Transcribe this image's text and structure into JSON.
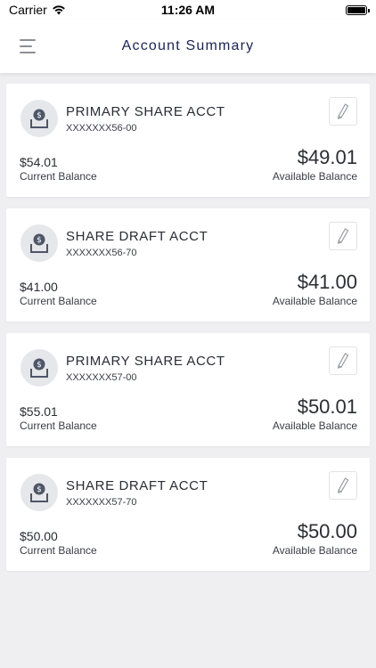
{
  "status_bar": {
    "carrier": "Carrier",
    "time": "11:26 AM"
  },
  "header": {
    "title": "Account Summary"
  },
  "accounts": [
    {
      "name": "PRIMARY SHARE ACCT",
      "number": "XXXXXXX56-00",
      "current_balance": "$54.01",
      "current_label": "Current Balance",
      "available_balance": "$49.01",
      "available_label": "Available Balance"
    },
    {
      "name": "SHARE DRAFT ACCT",
      "number": "XXXXXXX56-70",
      "current_balance": "$41.00",
      "current_label": "Current Balance",
      "available_balance": "$41.00",
      "available_label": "Available Balance"
    },
    {
      "name": "PRIMARY SHARE ACCT",
      "number": "XXXXXXX57-00",
      "current_balance": "$55.01",
      "current_label": "Current Balance",
      "available_balance": "$50.01",
      "available_label": "Available Balance"
    },
    {
      "name": "SHARE DRAFT ACCT",
      "number": "XXXXXXX57-70",
      "current_balance": "$50.00",
      "current_label": "Current Balance",
      "available_balance": "$50.00",
      "available_label": "Available Balance"
    }
  ],
  "icons": {
    "menu": "hamburger-menu-icon",
    "account": "money-deposit-icon",
    "edit": "pencil-icon",
    "wifi": "wifi-icon",
    "battery": "battery-icon"
  },
  "colors": {
    "title": "#1d2354",
    "background": "#efeff1",
    "card": "#ffffff"
  }
}
